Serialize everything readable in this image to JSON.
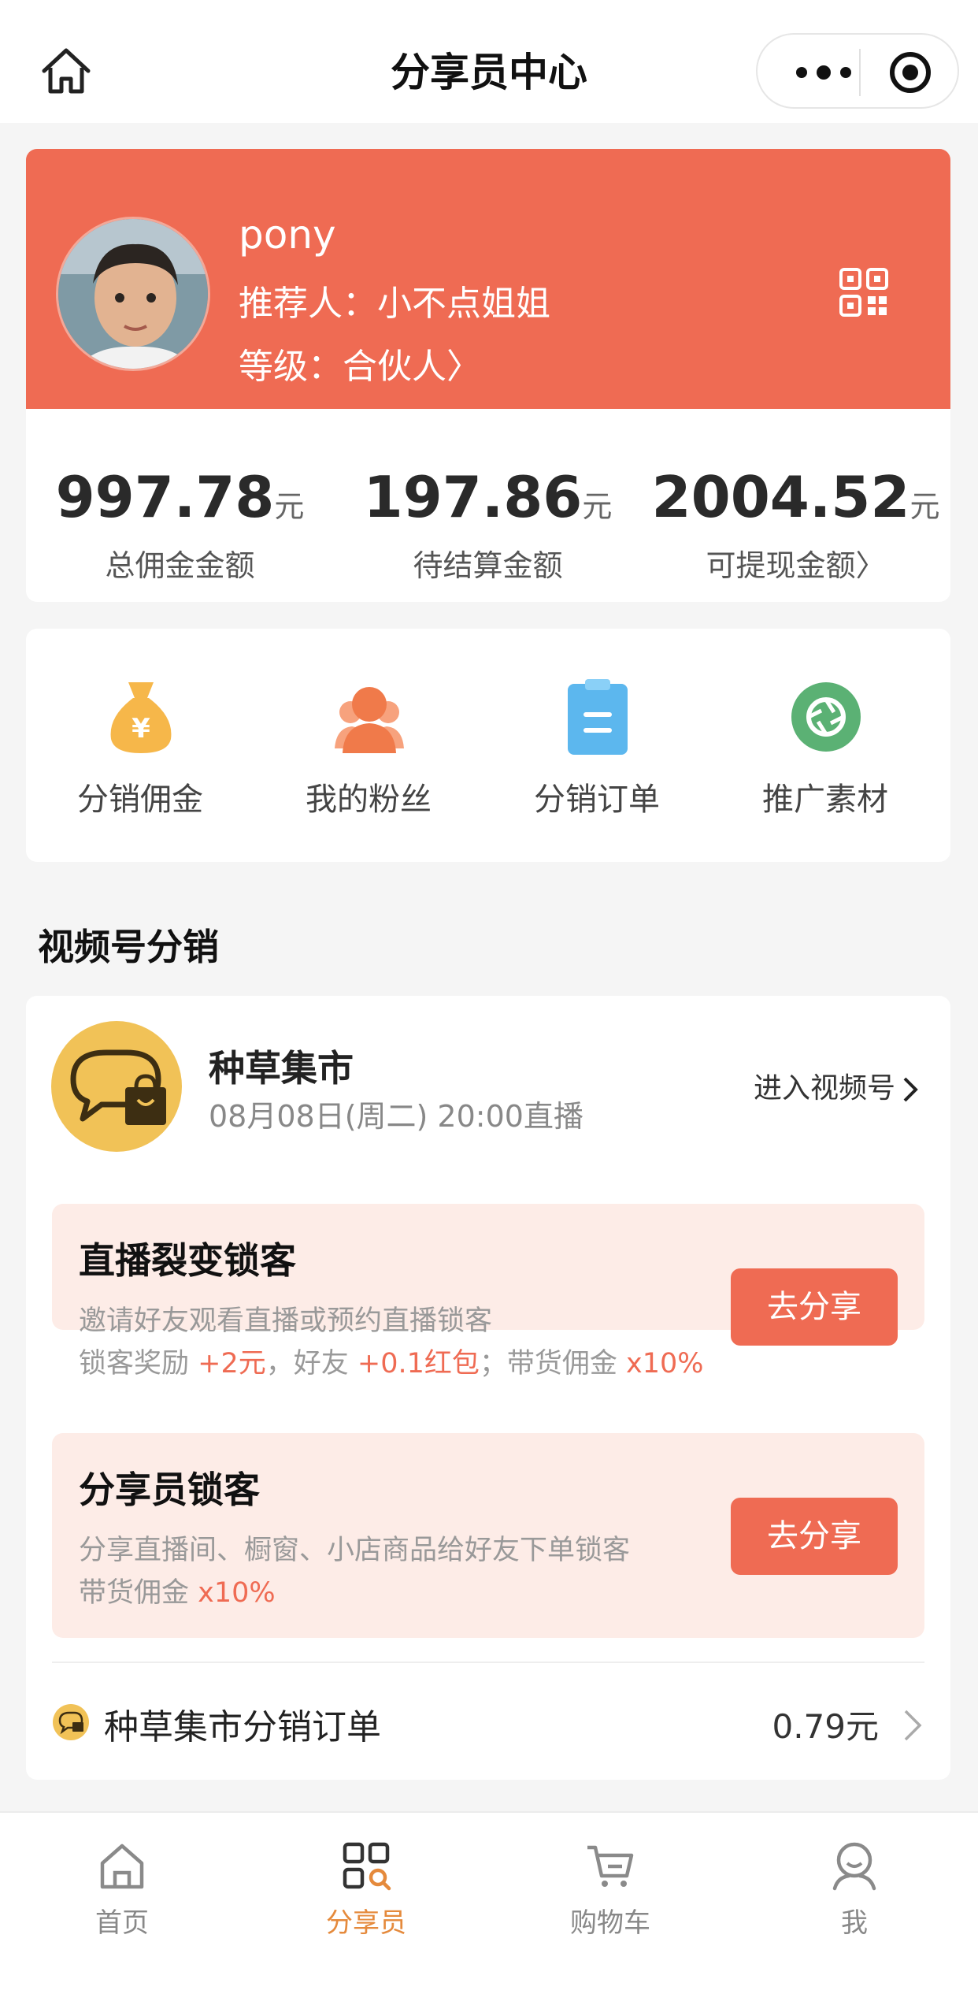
{
  "nav": {
    "title": "分享员中心"
  },
  "profile": {
    "name": "pony",
    "referrer": "推荐人：小不点姐姐",
    "level": "等级：合伙人",
    "level_chevron": "〉"
  },
  "stats": [
    {
      "value": "997.78",
      "unit": "元",
      "label": "总佣金金额"
    },
    {
      "value": "197.86",
      "unit": "元",
      "label": "待结算金额"
    },
    {
      "value": "2004.52",
      "unit": "元",
      "label": "可提现金额〉"
    }
  ],
  "menu": [
    {
      "label": "分销佣金",
      "icon": "money-bag-icon"
    },
    {
      "label": "我的粉丝",
      "icon": "fans-icon"
    },
    {
      "label": "分销订单",
      "icon": "clipboard-icon"
    },
    {
      "label": "推广素材",
      "icon": "aperture-icon"
    }
  ],
  "section": {
    "title": "视频号分销"
  },
  "shop": {
    "name": "种草集市",
    "time": "08月08日(周二) 20:00直播",
    "enter": "进入视频号"
  },
  "blocks": {
    "live": {
      "title": "直播裂变锁客",
      "line1": "邀请好友观看直播或预约直播锁客",
      "l2a": "锁客奖励 ",
      "l2b": "+2元",
      "l2c": "，好友 ",
      "l2d": "+0.1红包",
      "l2e": "；带货佣金 ",
      "l2f": "x10%",
      "button": "去分享"
    },
    "sharer": {
      "title": "分享员锁客",
      "line1": "分享直播间、橱窗、小店商品给好友下单锁客",
      "l2a": "带货佣金 ",
      "l2b": "x10%",
      "button": "去分享"
    }
  },
  "order_row": {
    "label": "种草集市分销订单",
    "value": "0.79元"
  },
  "tabs": [
    {
      "label": "首页",
      "icon": "home-icon"
    },
    {
      "label": "分享员",
      "icon": "grid-search-icon",
      "active": true
    },
    {
      "label": "购物车",
      "icon": "cart-icon"
    },
    {
      "label": "我",
      "icon": "user-icon"
    }
  ],
  "colors": {
    "accent": "#ef6b53",
    "tab_active": "#e58a3c",
    "block_bg": "#fdece7"
  }
}
